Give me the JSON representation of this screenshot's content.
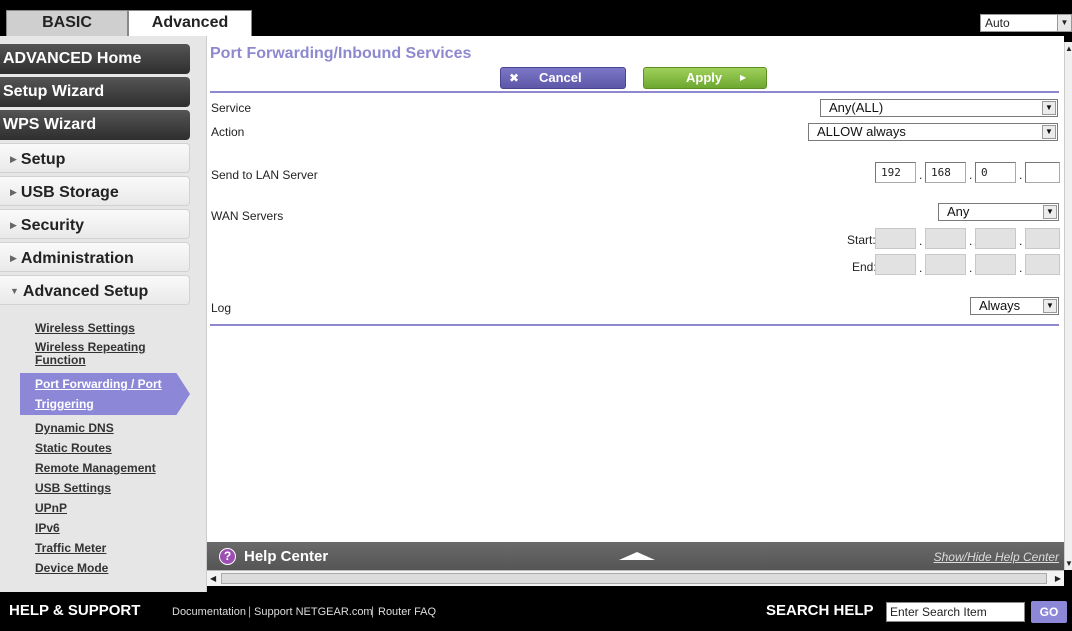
{
  "top_tabs": {
    "basic": "BASIC",
    "advanced": "Advanced"
  },
  "language": {
    "value": "Auto"
  },
  "sidebar": {
    "items": [
      {
        "label": "ADVANCED Home"
      },
      {
        "label": "Setup Wizard"
      },
      {
        "label": "WPS Wizard"
      },
      {
        "label": "Setup"
      },
      {
        "label": "USB Storage"
      },
      {
        "label": "Security"
      },
      {
        "label": "Administration"
      },
      {
        "label": "Advanced Setup"
      }
    ],
    "sub_items": [
      "Wireless Settings",
      "Wireless Repeating",
      "Function",
      "Port Forwarding / Port",
      "Triggering",
      "Dynamic DNS",
      "Static Routes",
      "Remote Management",
      "USB Settings",
      "UPnP",
      "IPv6",
      "Traffic Meter",
      "Device Mode"
    ]
  },
  "main": {
    "title": "Port Forwarding/Inbound Services",
    "cancel_label": "Cancel",
    "apply_label": "Apply",
    "service_label": "Service",
    "service_value": "Any(ALL)",
    "action_label": "Action",
    "action_value": "ALLOW always",
    "lan_server_label": "Send to LAN Server",
    "lan_ip": [
      "192",
      "168",
      "0",
      ""
    ],
    "wan_servers_label": "WAN Servers",
    "wan_value": "Any",
    "start_label": "Start:",
    "end_label": "End:",
    "log_label": "Log",
    "log_value": "Always"
  },
  "help": {
    "title": "Help Center",
    "toggle_label": "Show/Hide Help Center"
  },
  "footer": {
    "help_support": "HELP & SUPPORT",
    "links": [
      "Documentation",
      "Support NETGEAR.com",
      "Router FAQ"
    ],
    "search_label": "SEARCH HELP",
    "search_placeholder": "Enter Search Item",
    "go_label": "GO"
  },
  "colors": {
    "accent": "#8e89cf",
    "apply_green": "#7fb63c",
    "dark_bar": "#000000"
  }
}
